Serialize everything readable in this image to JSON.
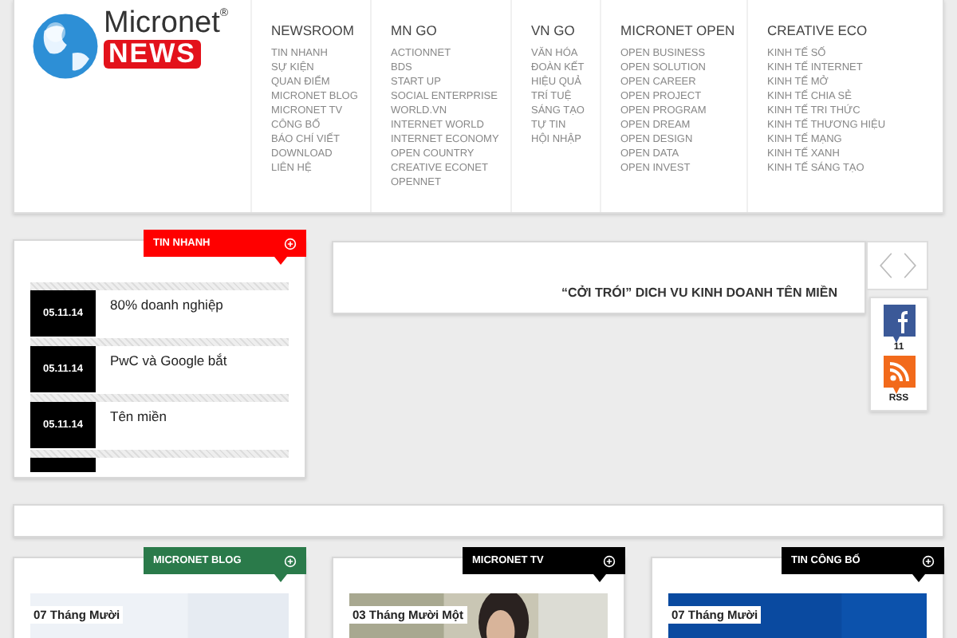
{
  "logo": {
    "brand": "Micronet",
    "mark": "®",
    "news": "NEWS"
  },
  "nav": [
    {
      "title": "NEWSROOM",
      "items": [
        "TIN NHANH",
        "SỰ KIỆN",
        "QUAN ĐIỂM",
        "MICRONET BLOG",
        "MICRONET TV",
        "CÔNG BỐ",
        "BÁO CHÍ VIẾT",
        "DOWNLOAD",
        "LIÊN HỆ"
      ]
    },
    {
      "title": "MN GO",
      "items": [
        "ACTIONNET",
        "BDS",
        "START UP",
        "SOCIAL ENTERPRISE",
        "WORLD.VN",
        "INTERNET WORLD",
        "INTERNET ECONOMY",
        "OPEN COUNTRY",
        "CREATIVE ECONET",
        "OPENNET"
      ]
    },
    {
      "title": "VN GO",
      "items": [
        "VĂN HÓA",
        "ĐOÀN KẾT",
        "HIỆU QUẢ",
        "TRÍ TUỆ",
        "SÁNG TẠO",
        "TỰ TIN",
        "HỘI NHẬP"
      ]
    },
    {
      "title": "MICRONET OPEN",
      "items": [
        "OPEN BUSINESS",
        "OPEN SOLUTION",
        "OPEN CAREER",
        "OPEN PROJECT",
        "OPEN PROGRAM",
        "OPEN DREAM",
        "OPEN DESIGN",
        "OPEN DATA",
        "OPEN INVEST"
      ]
    },
    {
      "title": "CREATIVE ECO",
      "items": [
        "KINH TẾ SỐ",
        "KINH TẾ INTERNET",
        "KINH TẾ MỞ",
        "KINH TẾ CHIA SẺ",
        "KINH TẾ TRI THỨC",
        "KINH TẾ THƯƠNG HIỆU",
        "KINH TẾ MẠNG",
        "KINH TẾ XANH",
        "KINH TẾ SÁNG TẠO"
      ]
    }
  ],
  "news_panel": {
    "title": "TIN NHANH",
    "color": "#ff0000",
    "items": [
      {
        "date": "05.11.14",
        "headline": "80% doanh nghiệp"
      },
      {
        "date": "05.11.14",
        "headline": "PwC và Google bắt"
      },
      {
        "date": "05.11.14",
        "headline": "Tên miền"
      }
    ]
  },
  "slider": {
    "caption": "“CỞI TRÓI” DICH VU KINH DOANH TÊN MIỀN"
  },
  "social": [
    {
      "kind": "facebook",
      "label": "11"
    },
    {
      "kind": "rss",
      "label": "RSS"
    }
  ],
  "sections": [
    {
      "title": "MICRONET BLOG",
      "color": "#2a7a4a",
      "date": "07 Tháng Mười"
    },
    {
      "title": "MICRONET TV",
      "color": "#000000",
      "date": "03 Tháng Mười Một"
    },
    {
      "title": "TIN CÔNG BỐ",
      "color": "#000000",
      "date": "07 Tháng Mười"
    }
  ]
}
